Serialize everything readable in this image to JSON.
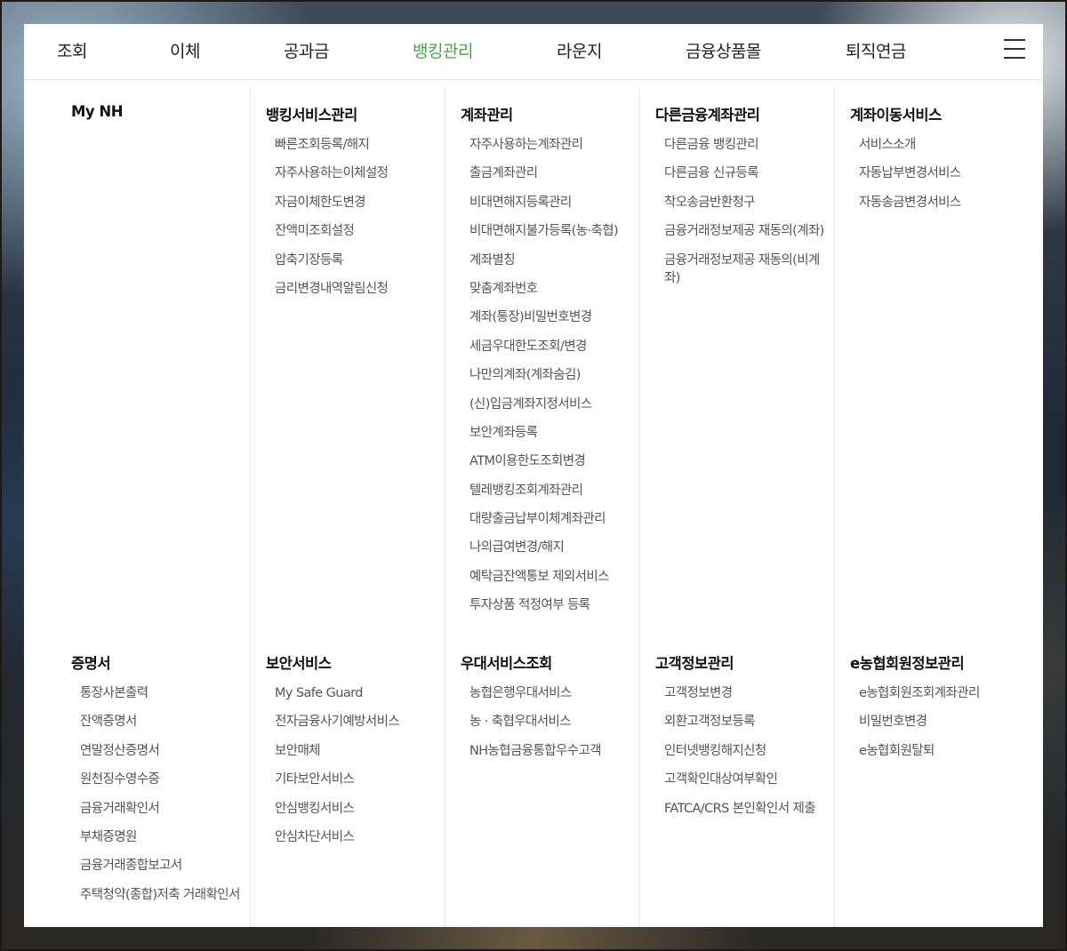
{
  "nav": {
    "items": [
      "조회",
      "이체",
      "공과금",
      "뱅킹관리",
      "라운지",
      "금융상품몰",
      "퇴직연금"
    ],
    "active": "뱅킹관리",
    "active_color": "#4aa34a",
    "menu_icon": "hamburger-menu-icon"
  },
  "columns": [
    {
      "top": {
        "title": "My NH",
        "items": []
      },
      "bottom": {
        "title": "증명서",
        "items": [
          "통장사본출력",
          "잔액증명서",
          "연말정산증명서",
          "원천징수영수증",
          "금융거래확인서",
          "부채증명원",
          "금융거래종합보고서",
          "주택청약(종합)저축 거래확인서"
        ]
      }
    },
    {
      "top": {
        "title": "뱅킹서비스관리",
        "items": [
          "빠른조회등록/해지",
          "자주사용하는이체설정",
          "자금이체한도변경",
          "잔액미조회설정",
          "압축기장등록",
          "금리변경내역알림신청"
        ]
      },
      "bottom": {
        "title": "보안서비스",
        "items": [
          "My Safe Guard",
          "전자금융사기예방서비스",
          "보안매체",
          "기타보안서비스",
          "안심뱅킹서비스",
          "안심차단서비스"
        ]
      }
    },
    {
      "top": {
        "title": "계좌관리",
        "items": [
          "자주사용하는계좌관리",
          "출금계좌관리",
          "비대면해지등록관리",
          "비대면해지불가등록(농·축협)",
          "계좌별칭",
          "맞춤계좌번호",
          "계좌(통장)비밀번호변경",
          "세금우대한도조회/변경",
          "나만의계좌(계좌숨김)",
          "(신)입금계좌지정서비스",
          "보안계좌등록",
          "ATM이용한도조회변경",
          "텔레뱅킹조회계좌관리",
          "대량출금납부이체계좌관리",
          "나의급여변경/해지",
          "예탁금잔액통보 제외서비스",
          "투자상품 적정여부 등록"
        ]
      },
      "bottom": {
        "title": "우대서비스조회",
        "items": [
          "농협은행우대서비스",
          "농 · 축협우대서비스",
          "NH농협금융통합우수고객"
        ]
      }
    },
    {
      "top": {
        "title": "다른금융계좌관리",
        "items": [
          "다른금융 뱅킹관리",
          "다른금융 신규등록",
          "착오송금반환청구",
          "금융거래정보제공 재동의(계좌)",
          "금융거래정보제공 재동의(비계좌)"
        ]
      },
      "bottom": {
        "title": "고객정보관리",
        "items": [
          "고객정보변경",
          "외환고객정보등록",
          "인터넷뱅킹해지신청",
          "고객확인대상여부확인",
          "FATCA/CRS 본인확인서 제출"
        ]
      }
    },
    {
      "top": {
        "title": "계좌이동서비스",
        "items": [
          "서비스소개",
          "자동납부변경서비스",
          "자동송금변경서비스"
        ]
      },
      "bottom": {
        "title": "e농협회원정보관리",
        "items": [
          "e농협회원조회계좌관리",
          "비밀번호변경",
          "e농협회원탈퇴"
        ]
      }
    }
  ]
}
